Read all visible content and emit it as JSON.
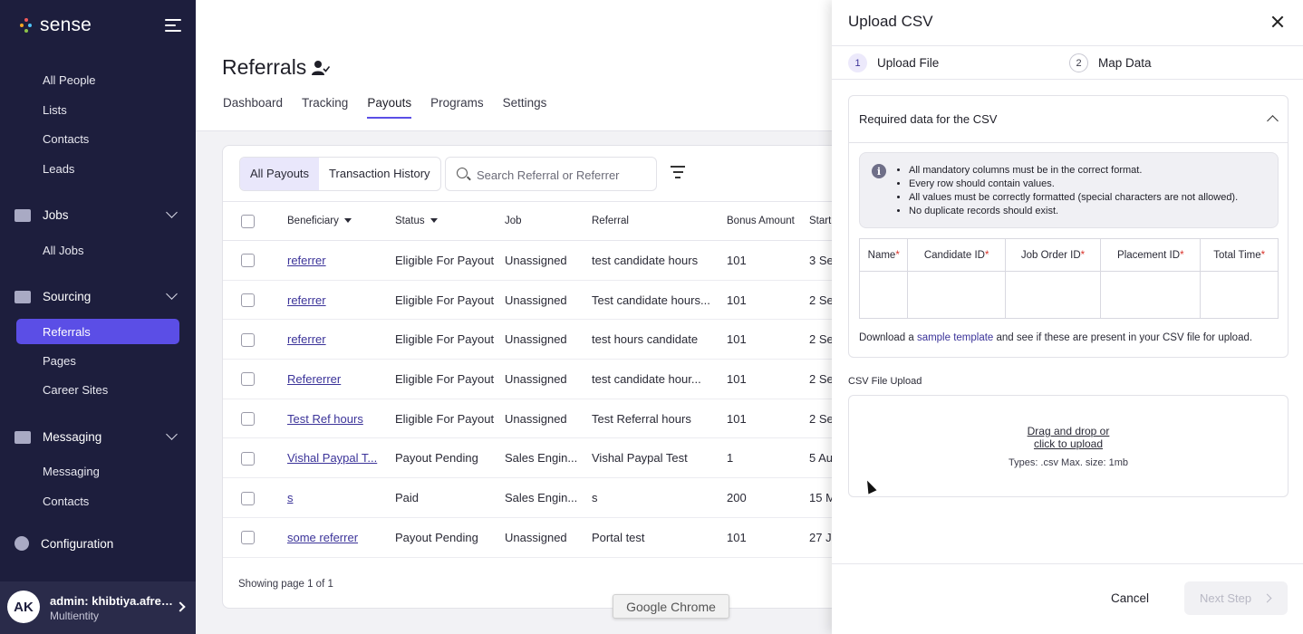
{
  "app": {
    "name": "sense"
  },
  "sidebar": {
    "top_items": [
      "All People",
      "Lists",
      "Contacts",
      "Leads"
    ],
    "jobs": {
      "label": "Jobs",
      "items": [
        "All Jobs"
      ]
    },
    "sourcing": {
      "label": "Sourcing",
      "items": [
        "Referrals",
        "Pages",
        "Career Sites"
      ]
    },
    "messaging": {
      "label": "Messaging",
      "items": [
        "Messaging",
        "Contacts"
      ]
    },
    "configuration": {
      "label": "Configuration"
    },
    "user": {
      "initials": "AK",
      "name": "admin: khibtiya.afree...",
      "org": "Multientity"
    }
  },
  "page": {
    "title": "Referrals",
    "tabs": [
      "Dashboard",
      "Tracking",
      "Payouts",
      "Programs",
      "Settings"
    ],
    "active_tab": "Payouts"
  },
  "payouts": {
    "segments": [
      "All Payouts",
      "Transaction History"
    ],
    "search_placeholder": "Search Referral or Referrer",
    "columns": [
      "Beneficiary",
      "Status",
      "Job",
      "Referral",
      "Bonus Amount",
      "Start"
    ],
    "rows": [
      [
        "referrer",
        "Eligible For Payout",
        "Unassigned",
        "test candidate hours",
        "101",
        "3 Se"
      ],
      [
        "referrer",
        "Eligible For Payout",
        "Unassigned",
        "Test candidate hours...",
        "101",
        "2 Se"
      ],
      [
        "referrer",
        "Eligible For Payout",
        "Unassigned",
        "test hours candidate",
        "101",
        "2 Se"
      ],
      [
        "Refererrer",
        "Eligible For Payout",
        "Unassigned",
        "test candidate hour...",
        "101",
        "2 Se"
      ],
      [
        "Test Ref hours",
        "Eligible For Payout",
        "Unassigned",
        "Test Referral hours",
        "101",
        "2 Se"
      ],
      [
        "Vishal Paypal T...",
        "Payout Pending",
        "Sales Engin...",
        "Vishal Paypal Test",
        "1",
        "5 Au"
      ],
      [
        "s",
        "Paid",
        "Sales Engin...",
        "s",
        "200",
        "15 M"
      ],
      [
        "some referrer",
        "Payout Pending",
        "Unassigned",
        "Portal test",
        "101",
        "27 J"
      ]
    ],
    "showing": "Showing page 1 of 1"
  },
  "chrome_tooltip": "Google Chrome",
  "upload_panel": {
    "title": "Upload CSV",
    "steps": [
      {
        "num": "1",
        "label": "Upload File"
      },
      {
        "num": "2",
        "label": "Map Data"
      }
    ],
    "required_title": "Required data for the CSV",
    "rules": [
      "All mandatory columns must be in the correct format.",
      "Every row should contain values.",
      "All values must be correctly formatted (special characters are not allowed).",
      "No duplicate records should exist."
    ],
    "required_columns": [
      "Name",
      "Candidate ID",
      "Job Order ID",
      "Placement ID",
      "Total Time"
    ],
    "download_prefix": "Download a ",
    "download_link": "sample template",
    "download_suffix": " and see if these are present in your CSV file for upload.",
    "upload_label": "CSV File Upload",
    "drop_line1": "Drag and drop or",
    "drop_line2": "click to upload",
    "drop_types": "Types: .csv Max. size: 1mb",
    "cancel": "Cancel",
    "next": "Next Step"
  },
  "colors": {
    "sidebar_bg": "#1d1e3d",
    "accent": "#5b4ee6",
    "link": "#3b3399"
  }
}
